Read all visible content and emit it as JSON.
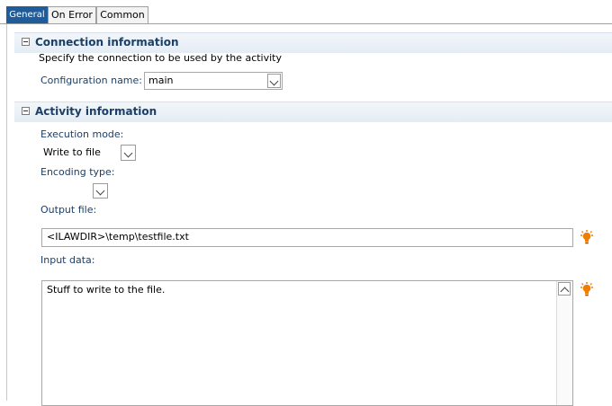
{
  "tabs": [
    {
      "label": "General",
      "active": true
    },
    {
      "label": "On Error",
      "active": false
    },
    {
      "label": "Common",
      "active": false
    }
  ],
  "connection": {
    "title": "Connection information",
    "description": "Specify the connection to be used by the activity",
    "config_label": "Configuration name:",
    "config_value": "main"
  },
  "activity": {
    "title": "Activity information",
    "execution_mode_label": "Execution mode:",
    "execution_mode_value": "Write to file",
    "encoding_type_label": "Encoding type:",
    "encoding_type_value": "",
    "output_file_label": "Output file:",
    "output_file_value": "<ILAWDIR>\\temp\\testfile.txt",
    "input_data_label": "Input data:",
    "input_data_value": "Stuff to write to the file."
  },
  "icons": {
    "section_toggle": "collapse-icon",
    "assist": "lightbulb-icon",
    "dropdown": "chevron-down-icon",
    "scroll_up": "chevron-up-icon"
  },
  "colors": {
    "active_tab": "#1f5c99",
    "section_title": "#1b3f66",
    "assist_icon": "#f07d00"
  }
}
